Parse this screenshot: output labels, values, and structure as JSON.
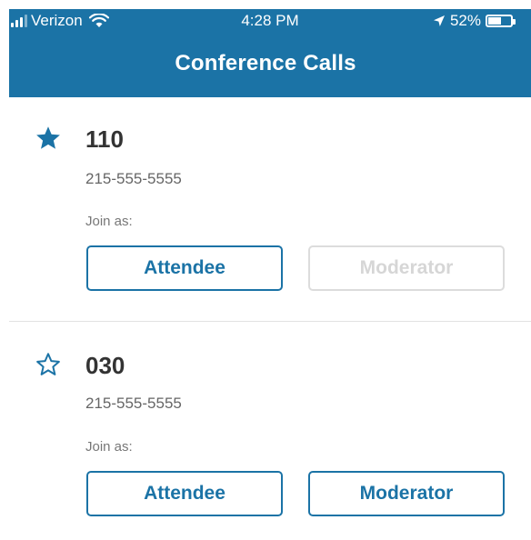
{
  "status_bar": {
    "carrier": "Verizon",
    "time": "4:28 PM",
    "battery": "52%",
    "battery_level": 0.52
  },
  "header": {
    "title": "Conference Calls"
  },
  "calls": [
    {
      "number": "110",
      "phone": "215-555-5555",
      "join_label": "Join as:",
      "favorite": true,
      "attendee_label": "Attendee",
      "moderator_label": "Moderator",
      "moderator_enabled": false
    },
    {
      "number": "030",
      "phone": "215-555-5555",
      "join_label": "Join as:",
      "favorite": false,
      "attendee_label": "Attendee",
      "moderator_label": "Moderator",
      "moderator_enabled": true
    }
  ],
  "colors": {
    "brand": "#1b73a6",
    "disabled": "#dcdcdc"
  },
  "icons": {
    "favorite_on": "star-filled-icon",
    "favorite_off": "star-outline-icon"
  }
}
